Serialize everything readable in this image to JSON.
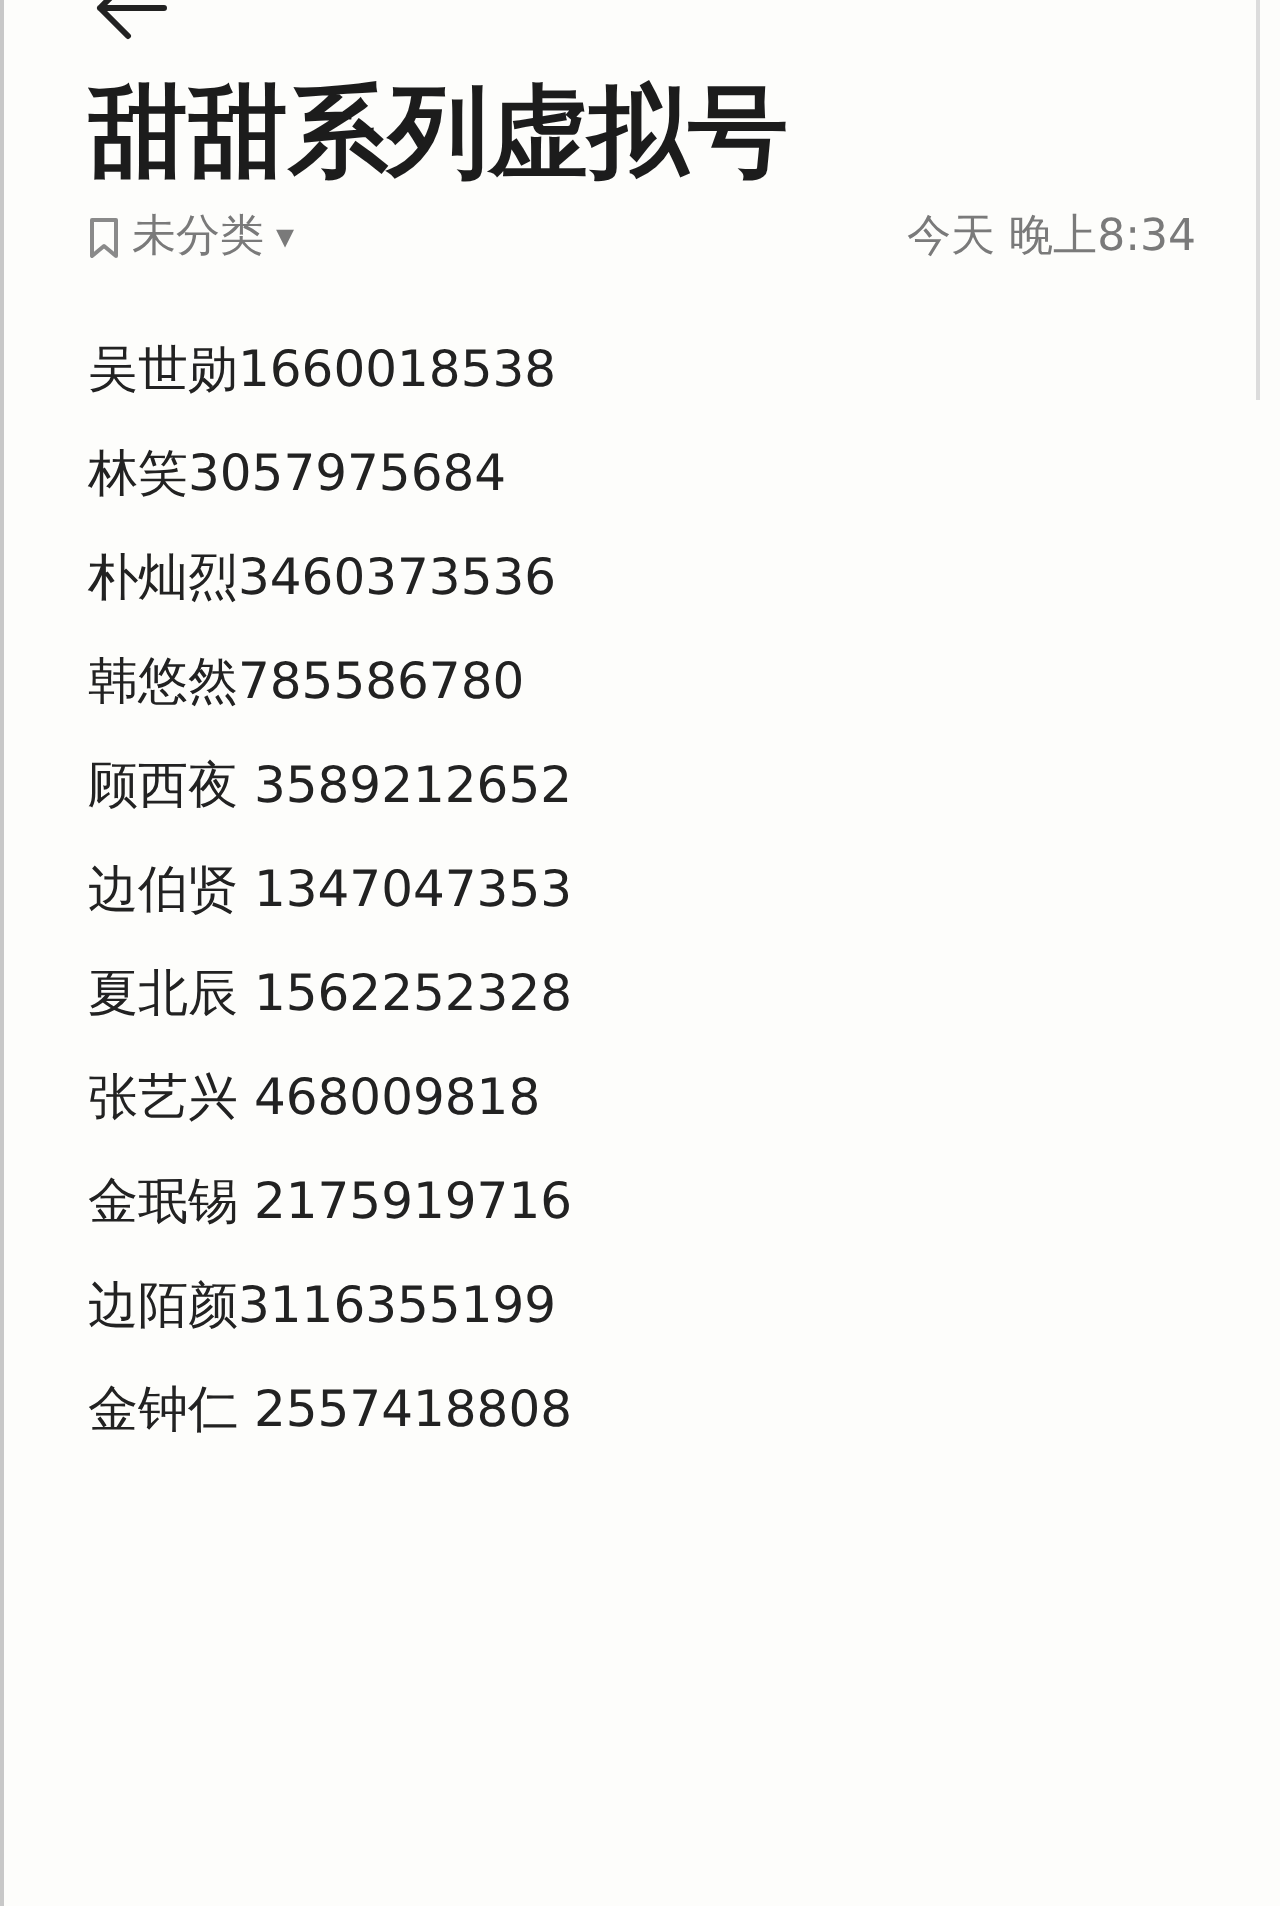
{
  "title": "甜甜系列虚拟号",
  "category": {
    "label": "未分类",
    "icon": "▾"
  },
  "timestamp": "今天 晚上8:34",
  "lines": [
    "吴世勋1660018538",
    "林笑3057975684",
    "朴灿烈3460373536",
    "韩悠然785586780",
    "顾西夜 3589212652",
    "边伯贤 1347047353",
    "夏北辰 1562252328",
    "张艺兴 468009818",
    "金珉锡 2175919716",
    "边陌颜3116355199",
    "金钟仁 2557418808"
  ]
}
